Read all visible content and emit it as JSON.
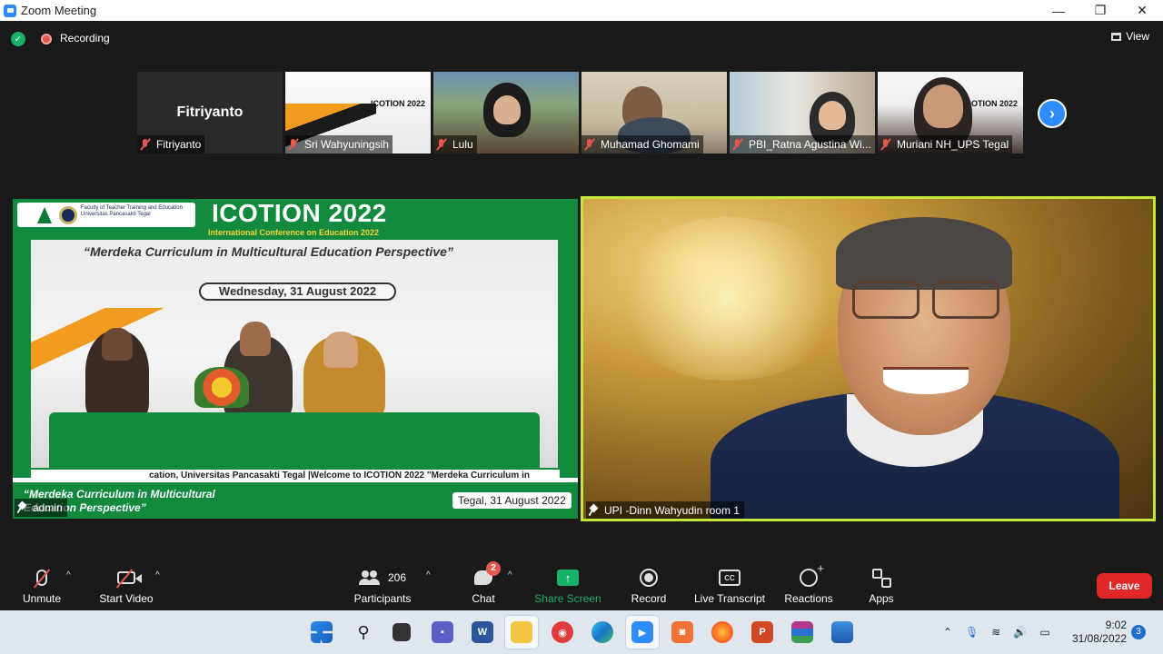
{
  "window": {
    "title": "Zoom Meeting",
    "controls": [
      "—",
      "❐",
      "✕"
    ]
  },
  "topbar": {
    "security_icon": "shield-check-icon",
    "recording_label": "Recording",
    "view_label": "View"
  },
  "strip": {
    "participants": [
      {
        "name": "Fitriyanto",
        "display_name": "Fitriyanto",
        "video": false,
        "muted": true
      },
      {
        "name": "Sri Wahyuningsih",
        "video": true,
        "muted": true,
        "slide_title": "ICOTION 2022"
      },
      {
        "name": "Lulu",
        "video": true,
        "muted": true
      },
      {
        "name": "Muhamad Ghomami",
        "video": true,
        "muted": true
      },
      {
        "name": "PBI_Ratna Agustina Wi...",
        "video": true,
        "muted": true
      },
      {
        "name": "Muriani NH_UPS Tegal",
        "video": true,
        "muted": true,
        "slide_title": "ICOTION 2022"
      }
    ],
    "next_icon": "chevron-right-icon"
  },
  "main_left": {
    "logo_text": "Faculty of Teacher Training and Education Universitas Pancasakti Tegal",
    "event_title": "ICOTION 2022",
    "event_subtitle": "International Conference on Education 2022",
    "theme": "“Merdeka Curriculum in Multicultural Education Perspective”",
    "date": "Wednesday, 31 August 2022",
    "ticker": "cation, Universitas Pancasakti Tegal |Welcome to ICOTION 2022 \"Merdeka Curriculum in",
    "bottom_text": "“Merdeka Curriculum in Multicultural Education Perspective”",
    "location_date": "Tegal, 31 August 2022",
    "participant_name": "admin"
  },
  "main_right": {
    "participant_name": "UPI -Dinn Wahyudin room 1"
  },
  "toolbar": {
    "unmute_label": "Unmute",
    "start_video_label": "Start Video",
    "participants_label": "Participants",
    "participants_count": "206",
    "chat_label": "Chat",
    "chat_badge": "2",
    "share_label": "Share Screen",
    "record_label": "Record",
    "transcript_label": "Live Transcript",
    "reactions_label": "Reactions",
    "apps_label": "Apps",
    "leave_label": "Leave",
    "cc_text": "CC",
    "share_color": "#17b26a",
    "leave_color": "#e02828"
  },
  "taskbar": {
    "time": "9:02",
    "date": "31/08/2022",
    "notification_count": "3",
    "apps": [
      "windows-start-icon",
      "search-icon",
      "task-view-icon",
      "teams-chat-icon",
      "word-icon",
      "file-explorer-icon",
      "photo-app-icon",
      "edge-icon",
      "zoom-icon",
      "screen-recorder-icon",
      "firefox-icon",
      "powerpoint-icon",
      "winrar-icon",
      "photos-icon"
    ]
  }
}
